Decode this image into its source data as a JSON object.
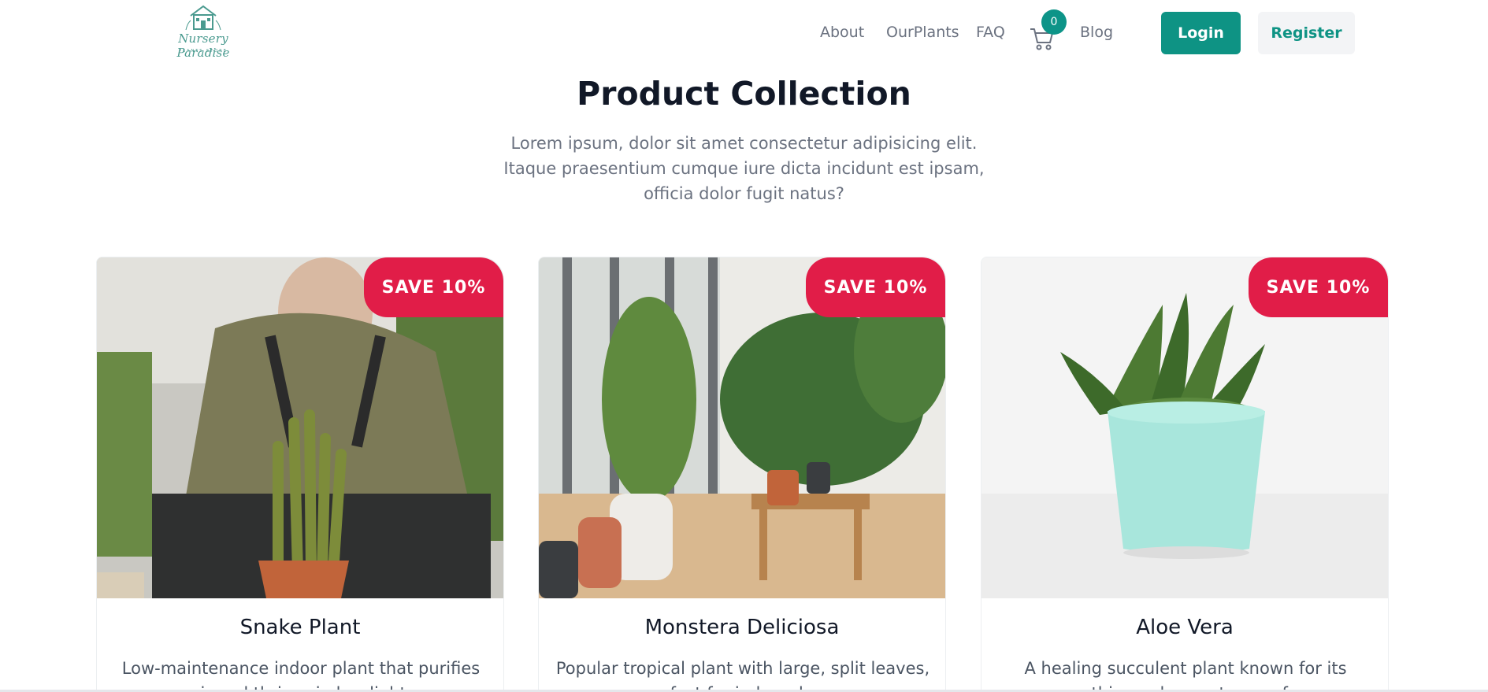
{
  "header": {
    "logo": {
      "title": "Nursery Paradise",
      "subtitle": "PLANTS STORE"
    },
    "nav": [
      {
        "label": "About"
      },
      {
        "label": "OurPlants"
      },
      {
        "label": "FAQ"
      },
      {
        "label": "Blog"
      }
    ],
    "cart": {
      "icon": "cart-icon",
      "count": "0"
    },
    "login_label": "Login",
    "register_label": "Register"
  },
  "hero": {
    "title": "Product Collection",
    "subtitle": "Lorem ipsum, dolor sit amet consectetur adipisicing elit. Itaque praesentium cumque iure dicta incidunt est ipsam, officia dolor fugit natus?"
  },
  "products": [
    {
      "badge": "SAVE 10%",
      "name": "Snake Plant",
      "description": "Low-maintenance indoor plant that purifies air and thrives in low light."
    },
    {
      "badge": "SAVE 10%",
      "name": "Monstera Deliciosa",
      "description": "Popular tropical plant with large, split leaves, perfect for indoor decor."
    },
    {
      "badge": "SAVE 10%",
      "name": "Aloe Vera",
      "description": "A healing succulent plant known for its soothing gel, easy to care for."
    }
  ],
  "colors": {
    "primary": "#0e9384",
    "badge": "#e11d48",
    "text": "#111827",
    "muted": "#6b7280"
  }
}
